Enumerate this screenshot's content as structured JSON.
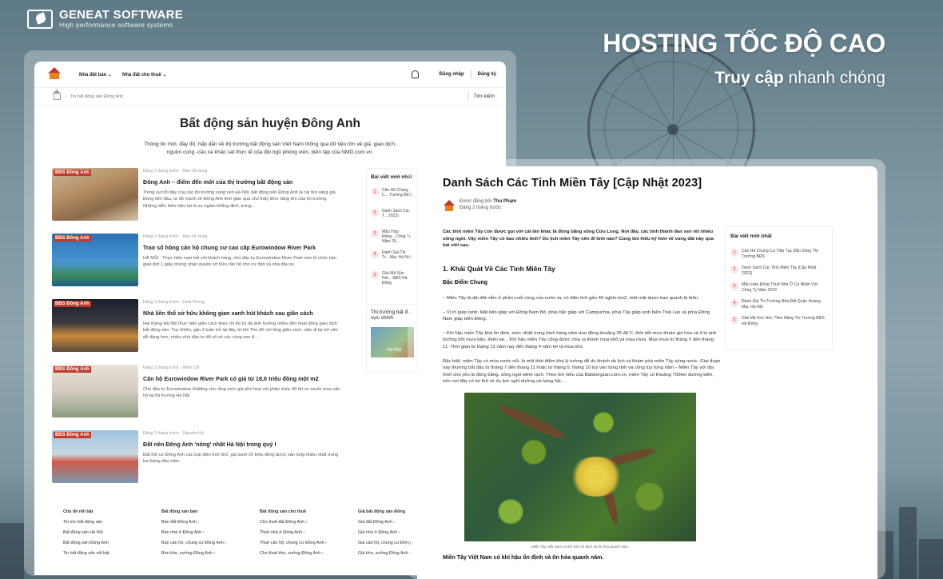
{
  "brand": {
    "name": "GENEAT SOFTWARE",
    "tagline": "High performance software systems"
  },
  "hero": {
    "title": "HOSTING TỐC ĐỘ CAO",
    "sub_bold": "Truy cập",
    "sub_rest": " nhanh chóng"
  },
  "page1": {
    "nav": {
      "menu": [
        "Nhà đất bán",
        "Nhà đất cho thuê"
      ],
      "login": "Đăng nhập",
      "register": "Đăng ký"
    },
    "breadcrumb": {
      "item": "Tin bất động sản Đông Anh",
      "search": "Tìm kiếm"
    },
    "title": "Bất động sản huyện Đông Anh",
    "lead": "Thông tin mới, đầy đủ, hấp dẫn về thị trường bất động sản Việt Nam thông qua dữ liệu lớn về giá, giao dịch, nguồn cung -cầu và khảo sát thực tế của đội ngũ phóng viên, biên tập của NMD.com.vn.",
    "articles": [
      {
        "tag": "BĐS Đông Anh",
        "meta": "Đăng 2 tháng trước - Ban nội dung",
        "title": "Đông Anh – điểm đến mới của thị trường bất động sản",
        "excerpt": "Trong sự trỗi dậy của các thị trường vùng ven Hà Nội, bất động sản Đông Anh là cái tên sáng giá. Đóng tiền đầu, tư đô mạnh về Đông Anh thời gian qua cho thấy tiềm năng lớn của thị trường. Những diễn biến hiện tại là sự ngầm khẳng định, trong..."
      },
      {
        "tag": "BĐS Đông Anh",
        "meta": "Đăng 2 tháng trước - Ban nội dung",
        "title": "Trao sổ hồng căn hộ chung cư cao cấp Eurowindow River Park",
        "excerpt": "HÀ NỘI - Thực hiện cam kết với khách hàng, chủ đầu tư Eurowindow River Park vừa tổ chức bàn giao đợt 1 giấy chứng nhận quyền sở hữu căn hộ cho cư dân và nhà đầu tư."
      },
      {
        "tag": "BĐS Đông Anh",
        "meta": "Đăng 2 tháng trước - Hoài Phong",
        "title": "Nhà liền thổ sở hữu không gian xanh hút khách sau giãn cách",
        "excerpt": "Hai tháng Hà Nội thực hiện giãn cách theo chỉ thị 16 đã ảnh hưởng nhiều đến hoạt động giao dịch bất động sản. Tuy nhiên, gần 3 tuần trở lại đây, từ khi Thủ đô nới lỏng giãn cách, việc đi lại trở nên dễ dàng hơn, nhiều nhà đầu tư đổ xô về các vùng ven đ..."
      },
      {
        "tag": "BĐS Đông Anh",
        "meta": "Đăng 2 tháng trước - Minh Chi",
        "title": "Căn hộ Eurowindow River Park có giá từ 18,6 triệu đồng một m2",
        "excerpt": "Chủ đầu tư Eurowindow Holding cho rằng mức giá phù hợp với phân khúc đô thị cư muốn mua căn hộ tại thị trường Hà Nội"
      },
      {
        "tag": "BĐS Đông Anh",
        "meta": "Đăng 2 tháng trước - Nguyễn Hà",
        "title": "Đất nền Đông Anh 'nóng' nhất Hà Nội trong quý I",
        "excerpt": "Đất thổ cư Đông Anh các loại diện tích nhỏ, giá dưới 20 triệu đồng được săn lùng nhiều nhất trong ba tháng đầu năm."
      }
    ],
    "sidebar": {
      "title": "Bài viết mới nhất",
      "items": [
        "Căn Hộ Chung C... Trường BĐS",
        "Danh Sách Các T... 2023)",
        "Mẫu Hợp Đồng... Công Ty Năm 20...",
        "Đánh Giá Thị Tr... Mai, Hà Nội",
        "Giải Mã Sức Hút... BĐS Hà Đông"
      ]
    },
    "sidebar2": {
      "title": "Thị trường bất đ... vực chính",
      "img_label": "Hà Nội"
    },
    "footer": [
      {
        "head": "Chủ đề nổi bật",
        "items": [
          "Tin tức bất động sản",
          "Bất động sản Hà Nội",
          "Bất động sản Đông Anh",
          "Tin bất động sản nổi bật"
        ]
      },
      {
        "head": "Bất động sản bán",
        "items": [
          "Bán đất Đông Anh",
          "Bán nhà ở Đông Anh",
          "Bán căn hộ, chung cư Đông Anh",
          "Bán kho, xưởng Đông Anh"
        ]
      },
      {
        "head": "Bất động sản cho thuê",
        "items": [
          "Cho thuê đất Đông Anh",
          "Thuê nhà ở Đông Anh",
          "Thuê căn hộ, chung cư Đông Anh",
          "Cho thuê kho, xưởng Đông Anh"
        ]
      },
      {
        "head": "Giá bất động sản Đông",
        "items": [
          "Giá đất Đông Anh",
          "Giá nhà ở Đông Anh",
          "Giá căn hộ, chung cư Đông",
          "Giá kho, xưởng Đông Anh"
        ]
      }
    ]
  },
  "page2": {
    "title": "Danh Sách Các Tỉnh Miền Tây [Cập Nhật 2023]",
    "author_prefix": "Được đăng bởi",
    "author": "Thu Phạm",
    "date": "Đăng 2 tháng trước",
    "intro": "Các tỉnh miền Tây còn được gọi với cái tên khác là đồng bằng sông Cửu Long. Nơi đây, các tỉnh thành đan xen rết nhiều sông ngòi. Vậy miền Tây có bao nhiêu tỉnh? Du lịch miền Tây nên đi tỉnh nào? Cùng tìm hiểu kỹ hơn về vùng đất này qua bài viết sau.",
    "h2": "1. Khái Quát Về Các Tỉnh Miền Tây",
    "h3": "Đặc Điểm Chung",
    "paras": [
      "– Miền Tây là dải đất nằm ở phần cuối cùng của nước ta, có diện tích gần 40 nghìn km2, một mặt được bao quanh là biển.",
      "– Vị trí giáp ranh: Mặt bên giáp với Đông Nam Bộ, phía bắc giáp với Campuchia, phía Tây giáp vịnh biển Thái Lan và phía Đông Nam giáp biển Đông.",
      "– Khí hậu miền Tây khá ổn định, mức nhiệt trung bình hàng năm dao động khoảng 28 độ C, thời tiết mưa thuận gió hòa và ít bị ảnh hưởng bởi mưa bão, thiên tai... Khí hậu miền Tây cũng được chia ra thành mùa khô và mùa mưa. Mùa mưa từ tháng 5 đến tháng 11. Thời gian từ tháng 12 năm nay đến tháng 4 năm tới là mùa khô.",
      "Đặc biệt, miền Tây có mùa nước nổi, là một thời điểm khá lý tưởng để du khách du lịch và khám phá miền Tây sông nước. Giai đoạn này thường bắt đầu từ tháng 7 đến tháng 11 hoặc từ tháng 9, tháng 10 tùy vào từng tỉnh và cũng tùy từng năm.– Miền Tây với địa hình chủ yếu là đồng bằng, sông ngòi kênh rạch. Theo tìm hiểu của Batdongsan.com.vn, miền Tây có khoảng 700km đường biển, nên nơi đây có lợi thế về du lịch nghỉ dưỡng và hàng hải, ..."
    ],
    "caption": "Miền Tây Việt Nam có khí hậu ổn định và ôn hòa quanh năm.",
    "bottom": "Miền Tây Việt Nam có khí hậu ổn định và ôn hòa quanh năm.",
    "sidebar": {
      "title": "Bài viết mới nhất",
      "items": [
        "Căn Hộ Chung Cư Tiếp Tục Dẫn Sóng Thị Trường BĐS",
        "Danh Sách Các Tỉnh Miền Tây [Cập Nhật 2023]",
        "Mẫu Hợp Đồng Thuê Nhà Ở Cá Nhân Với Công Ty Năm 2023",
        "Đánh Giá Thị Trường Nhà Đất Quận Hoàng Mai, Hà Nội",
        "Giải Mã Sức Hút, Tiềm Năng Thị Trường BĐS Hà Đông"
      ]
    }
  }
}
